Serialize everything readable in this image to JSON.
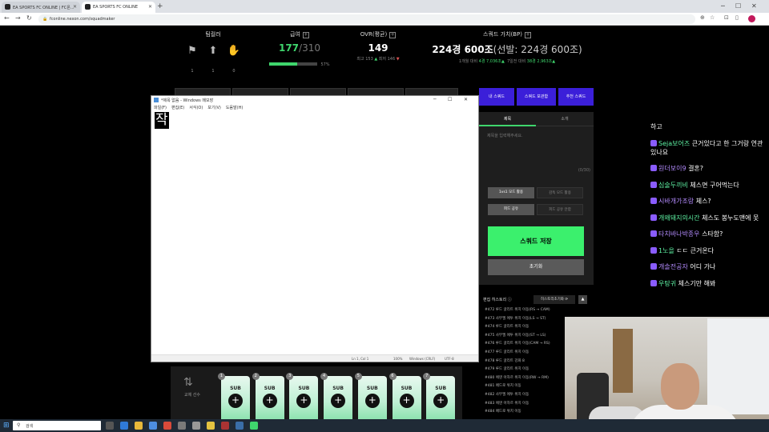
{
  "browser": {
    "tabs": [
      {
        "label": "EA SPORTS FC ONLINE | FC온..."
      },
      {
        "label": "EA SPORTS FC ONLINE"
      }
    ],
    "url": "fconline.nexon.com/squadmaker"
  },
  "stats": {
    "teamcolor": {
      "label": "팀컬러",
      "counts": [
        "1",
        "1",
        "0"
      ]
    },
    "salary": {
      "label": "급여",
      "current": "177",
      "max": "/310",
      "percent": "57%",
      "fill": 0.57
    },
    "ovr": {
      "label": "OVR(평균)",
      "value": "149",
      "best": "최고 153",
      "worst": "최저 146"
    },
    "value": {
      "label": "스쿼드 가치(BP)",
      "main": "224경 600조",
      "sub": "(선발: 224경 600조)",
      "week1": "1개월 대비",
      "week1_val": "4경 7,036조",
      "week2": "7일전 대비",
      "week2_val": "38경 2,963조"
    }
  },
  "notepad": {
    "title": "*제목 없음 - Windows 메모장",
    "menu": [
      "파일(F)",
      "편집(E)",
      "서식(O)",
      "보기(V)",
      "도움말(H)"
    ],
    "content": "작",
    "status": {
      "pos": "Ln 1, Col 1",
      "zoom": "100%",
      "eol": "Windows (CRLF)",
      "enc": "UTF-8"
    }
  },
  "squad": {
    "tabs": [
      "내 스쿼드",
      "스쿼드 보관함",
      "추천 스쿼드"
    ],
    "subtabs": [
      "제목",
      "소개"
    ],
    "title_placeholder": "제목을 입력해주세요.",
    "char_count": "(0/30)",
    "mode_buttons": [
      "1vs1 모드 활용",
      "감독 모드 활용"
    ],
    "share_buttons": [
      "피드 공유",
      "피드 공유 안함"
    ],
    "save": "스쿼드 저장",
    "reset": "초기화"
  },
  "history": {
    "title": "편집 히스토리",
    "reset": "히스토리초기화 ⟳",
    "items": [
      "#472 루드 굴리트 위치 이동(RS → CAM)",
      "#473 사무엘 에투 위치 이동(LS → ST)",
      "#474 루드 굴리트 위치 이동",
      "#475 사무엘 에투 위치 이동(ST → LS)",
      "#476 루드 굴리트 위치 이동(CAM → RS)",
      "#477 루드 굴리트 위치 이동",
      "#478 루드 굴리트 강화 8",
      "#479 루드 굴리트 위치 이동",
      "#480 에덴 아자르 위치 이동(RW → RM)",
      "#481 페드로 위치 이동",
      "#482 사무엘 에투 위치 이동",
      "#483 에덴 아자르 위치 이동",
      "#484 페드로 위치 이동"
    ]
  },
  "bench": {
    "label": "교체 선수",
    "cards": [
      {
        "label": "SUB",
        "add": "+",
        "badge": "1"
      },
      {
        "label": "SUB",
        "add": "+",
        "badge": "2"
      },
      {
        "label": "SUB",
        "add": "+",
        "badge": "3"
      },
      {
        "label": "SUB",
        "add": "+",
        "badge": "4"
      },
      {
        "label": "SUB",
        "add": "+",
        "badge": "5"
      },
      {
        "label": "SUB",
        "add": "+",
        "badge": "6"
      },
      {
        "label": "SUB",
        "add": "+",
        "badge": "7"
      }
    ]
  },
  "chat": [
    {
      "nick": "",
      "text": "하고"
    },
    {
      "nick": "Seja보어즈",
      "text": " 큰거있다고 한 그거랑 연관 있나요"
    },
    {
      "nick": "원더보이9",
      "text": " 결혼?"
    },
    {
      "nick": "심술두끼비",
      "text": " 체스면 구어먹는다"
    },
    {
      "nick": "시바개가조랑",
      "text": " 체스?"
    },
    {
      "nick": "개왜돼지의시간",
      "text": " 체스도 봉누도맨에 못"
    },
    {
      "nick": "타치바나박종우",
      "text": " 스타함?"
    },
    {
      "nick": "1노을",
      "text": " ㄷㄷ 큰거온다"
    },
    {
      "nick": "개솔전공자",
      "text": " 어디 가나"
    },
    {
      "nick": "우탕귀",
      "text": " 체스기만 해봐"
    }
  ],
  "taskbar": {
    "search": "검색"
  }
}
